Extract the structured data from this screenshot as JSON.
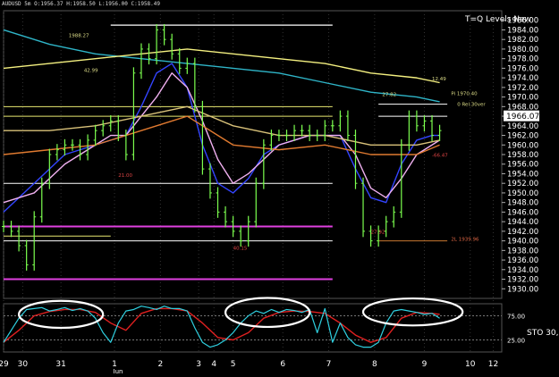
{
  "header": {
    "symbol_line": "AUDUSD 5m O:1956.37 H:1958.50 L:1956.00 C:1958.49",
    "indicator_title": "T=Q Levels New",
    "current_price_label": "1966.07"
  },
  "colors": {
    "background": "#000000",
    "price_bars": "#7CFF4F",
    "ma_blue": "#3344FF",
    "ma_cyan": "#2FB5C8",
    "ma_pink": "#F0B0F0",
    "ma_orange": "#E07A30",
    "ma_tan": "#D9C27A",
    "ma_yellow": "#F4F080",
    "level_white": "#FFFFFF",
    "level_magenta": "#E040E0",
    "level_yellow": "#E8E870",
    "stoch_k": "#2FD0E0",
    "stoch_d": "#E02020",
    "ellipse": "#FFFFFF"
  },
  "chart_data": [
    {
      "type": "line",
      "panel": "price",
      "ylim": [
        1928,
        1988
      ],
      "y_ticks": [
        1930,
        1932,
        1934,
        1936,
        1938,
        1940,
        1942,
        1944,
        1946,
        1948,
        1950,
        1952,
        1954,
        1956,
        1958,
        1960,
        1962,
        1964,
        1966,
        1968,
        1970,
        1972,
        1974,
        1976,
        1978,
        1980,
        1982,
        1984,
        1986
      ],
      "x_ticks": [
        {
          "label": "29",
          "t": 0.0
        },
        {
          "label": "30",
          "t": 2.5
        },
        {
          "label": "31",
          "t": 7.5
        },
        {
          "label": "1",
          "t": 14.5
        },
        {
          "label": "2",
          "t": 20.5
        },
        {
          "label": "3",
          "t": 25.5
        },
        {
          "label": "4",
          "t": 27.5
        },
        {
          "label": "5",
          "t": 30.0
        },
        {
          "label": "6",
          "t": 36.5
        },
        {
          "label": "7",
          "t": 42.5
        },
        {
          "label": "8",
          "t": 48.5
        },
        {
          "label": "9",
          "t": 55.0
        },
        {
          "label": "10",
          "t": 61.0
        },
        {
          "label": "12",
          "t": 64.0
        }
      ],
      "x_sublabel": {
        "label": "Jun",
        "t": 14.5
      },
      "xlim": [
        0,
        65
      ],
      "series": [
        {
          "key": "price",
          "x": [
            0,
            1,
            2,
            3,
            4,
            5,
            6,
            7,
            8,
            9,
            10,
            11,
            12,
            13,
            14,
            15,
            16,
            17,
            18,
            19,
            20,
            21,
            22,
            23,
            24,
            25,
            26,
            27,
            28,
            29,
            30,
            31,
            32,
            33,
            34,
            35,
            36,
            37,
            38,
            39,
            40,
            41,
            42,
            43,
            44,
            45,
            46,
            47,
            48,
            49,
            50,
            51,
            52,
            53,
            54,
            55,
            56,
            57
          ],
          "y": [
            1943,
            1942,
            1939,
            1935,
            1945,
            1952,
            1958,
            1959,
            1960,
            1960,
            1958,
            1961,
            1963,
            1964,
            1965,
            1962,
            1958,
            1975,
            1980,
            1978,
            1984,
            1982,
            1979,
            1976,
            1977,
            1968,
            1955,
            1950,
            1946,
            1944,
            1942,
            1940,
            1944,
            1952,
            1960,
            1962,
            1962,
            1962,
            1963,
            1963,
            1962,
            1962,
            1964,
            1964,
            1966,
            1962,
            1952,
            1942,
            1940,
            1942,
            1944,
            1946,
            1960,
            1966,
            1964,
            1965,
            1962,
            1963
          ]
        },
        {
          "key": "ma_blue",
          "x": [
            0,
            4,
            8,
            12,
            14,
            16,
            18,
            20,
            22,
            24,
            26,
            28,
            30,
            32,
            34,
            36,
            38,
            40,
            42,
            44,
            46,
            48,
            50,
            52,
            54,
            56,
            57
          ],
          "y": [
            1946,
            1952,
            1958,
            1960,
            1961,
            1962,
            1968,
            1975,
            1977,
            1972,
            1960,
            1952,
            1950,
            1953,
            1958,
            1960,
            1961,
            1962,
            1962,
            1962,
            1955,
            1949,
            1948,
            1956,
            1961,
            1962,
            1962
          ]
        },
        {
          "key": "ma_pink",
          "x": [
            0,
            4,
            8,
            12,
            14,
            16,
            18,
            20,
            22,
            24,
            26,
            28,
            30,
            32,
            34,
            36,
            38,
            40,
            42,
            44,
            46,
            48,
            50,
            52,
            54,
            56,
            57
          ],
          "y": [
            1948,
            1950,
            1956,
            1960,
            1962,
            1962,
            1966,
            1970,
            1975,
            1972,
            1965,
            1957,
            1952,
            1954,
            1957,
            1960,
            1961,
            1962,
            1962,
            1962,
            1958,
            1951,
            1949,
            1953,
            1958,
            1960,
            1961
          ]
        },
        {
          "key": "ma_orange",
          "x": [
            0,
            6,
            12,
            18,
            24,
            30,
            36,
            42,
            48,
            54,
            57
          ],
          "y": [
            1958,
            1959,
            1960,
            1963,
            1966,
            1960,
            1959,
            1960,
            1958,
            1958,
            1960
          ]
        },
        {
          "key": "ma_tan",
          "x": [
            0,
            6,
            12,
            18,
            24,
            30,
            36,
            42,
            48,
            54,
            57
          ],
          "y": [
            1963,
            1963,
            1964,
            1966,
            1968,
            1964,
            1962,
            1962,
            1960,
            1960,
            1961
          ]
        },
        {
          "key": "ma_cyan",
          "x": [
            0,
            6,
            12,
            18,
            24,
            30,
            36,
            42,
            48,
            54,
            57
          ],
          "y": [
            1984,
            1981,
            1979,
            1978,
            1977,
            1976,
            1975,
            1973,
            1971,
            1970,
            1969
          ]
        },
        {
          "key": "ma_yellow",
          "x": [
            0,
            6,
            12,
            18,
            24,
            30,
            36,
            42,
            48,
            54,
            57
          ],
          "y": [
            1976,
            1977,
            1978,
            1979,
            1980,
            1979,
            1978,
            1977,
            1975,
            1974,
            1973
          ]
        }
      ],
      "levels": [
        {
          "y": 1985,
          "x0": 14,
          "x1": 43,
          "color": "level_white",
          "width": 1.2
        },
        {
          "y": 1968,
          "x0": 0,
          "x1": 43,
          "color": "level_yellow",
          "width": 1
        },
        {
          "y": 1966,
          "x0": 0,
          "x1": 43,
          "color": "level_yellow",
          "width": 1
        },
        {
          "y": 1952,
          "x0": 0,
          "x1": 43,
          "color": "level_white",
          "width": 1
        },
        {
          "y": 1968.5,
          "x0": 49,
          "x1": 58,
          "color": "level_white",
          "width": 1
        },
        {
          "y": 1966,
          "x0": 49,
          "x1": 58,
          "color": "level_white",
          "width": 1
        },
        {
          "y": 1943,
          "x0": 0,
          "x1": 28,
          "color": "level_magenta",
          "width": 2
        },
        {
          "y": 1943,
          "x0": 28,
          "x1": 43,
          "color": "level_magenta",
          "width": 2
        },
        {
          "y": 1932,
          "x0": 0,
          "x1": 43,
          "color": "level_magenta",
          "width": 2
        },
        {
          "y": 1941,
          "x0": 0,
          "x1": 14,
          "color": "level_yellow",
          "width": 1
        },
        {
          "y": 1940,
          "x0": 0,
          "x1": 43,
          "color": "level_white",
          "width": 1
        },
        {
          "y": 1940,
          "x0": 49,
          "x1": 58,
          "color": "level_orange",
          "width": 1
        }
      ],
      "annotations": [
        {
          "text": "1988.27",
          "x": 8.5,
          "y": 1982.5,
          "color": "#dddd88"
        },
        {
          "text": "42.99",
          "x": 10.5,
          "y": 1975.2,
          "color": "#dddd88"
        },
        {
          "text": "27.82",
          "x": 49.5,
          "y": 1970.2,
          "color": "#dddd88"
        },
        {
          "text": "12.49",
          "x": 56,
          "y": 1973.5,
          "color": "#dddd88"
        },
        {
          "text": "Pi 1970.40",
          "x": 58.5,
          "y": 1970.4,
          "color": "#dddd88"
        },
        {
          "text": "0 Rel.30ver",
          "x": 59.3,
          "y": 1968.2,
          "color": "#dddd88"
        },
        {
          "text": "21.00",
          "x": 15,
          "y": 1953.3,
          "color": "#dd4444"
        },
        {
          "text": "40.15",
          "x": 30,
          "y": 1938.2,
          "color": "#dd4444"
        },
        {
          "text": "27.92",
          "x": 48,
          "y": 1941.5,
          "color": "#dd4444"
        },
        {
          "text": "-66.47",
          "x": 56,
          "y": 1957.5,
          "color": "#dd4444"
        },
        {
          "text": "2L 1939.96",
          "x": 58.5,
          "y": 1940,
          "color": "#dd6644"
        }
      ]
    },
    {
      "type": "line",
      "panel": "stochastic",
      "title": "STO 30,",
      "ylim": [
        0,
        100
      ],
      "y_ticks_labeled": [
        75,
        25
      ],
      "levels": [
        75,
        25
      ],
      "series": [
        {
          "key": "stoch_k",
          "x": [
            0,
            1,
            2,
            3,
            4,
            5,
            6,
            7,
            8,
            9,
            10,
            11,
            12,
            13,
            14,
            15,
            16,
            17,
            18,
            19,
            20,
            21,
            22,
            23,
            24,
            25,
            26,
            27,
            28,
            29,
            30,
            31,
            32,
            33,
            34,
            35,
            36,
            37,
            38,
            39,
            40,
            41,
            42,
            43,
            44,
            45,
            46,
            47,
            48,
            49,
            50,
            51,
            52,
            53,
            54,
            55,
            56,
            57
          ],
          "y": [
            20,
            45,
            70,
            88,
            90,
            92,
            85,
            88,
            92,
            86,
            90,
            85,
            70,
            40,
            20,
            60,
            85,
            88,
            95,
            92,
            88,
            95,
            90,
            90,
            85,
            50,
            20,
            10,
            15,
            25,
            40,
            60,
            75,
            85,
            80,
            88,
            82,
            88,
            86,
            82,
            88,
            40,
            90,
            20,
            60,
            30,
            15,
            10,
            10,
            20,
            60,
            85,
            88,
            85,
            82,
            78,
            80,
            70
          ]
        },
        {
          "key": "stoch_d",
          "x": [
            0,
            2,
            4,
            6,
            8,
            10,
            12,
            14,
            16,
            18,
            20,
            22,
            24,
            26,
            28,
            30,
            32,
            34,
            36,
            38,
            40,
            42,
            44,
            46,
            48,
            50,
            52,
            54,
            56,
            57
          ],
          "y": [
            20,
            45,
            75,
            84,
            88,
            88,
            82,
            60,
            45,
            80,
            90,
            90,
            85,
            60,
            30,
            25,
            40,
            70,
            82,
            85,
            84,
            80,
            60,
            35,
            20,
            30,
            70,
            82,
            80,
            78
          ]
        }
      ],
      "ellipses": [
        {
          "cx": 7.5,
          "cy": 78,
          "rx": 5.5,
          "ry": 28
        },
        {
          "cx": 34.5,
          "cy": 82,
          "rx": 5.5,
          "ry": 30
        },
        {
          "cx": 53.5,
          "cy": 83,
          "rx": 6.5,
          "ry": 28
        }
      ]
    }
  ]
}
